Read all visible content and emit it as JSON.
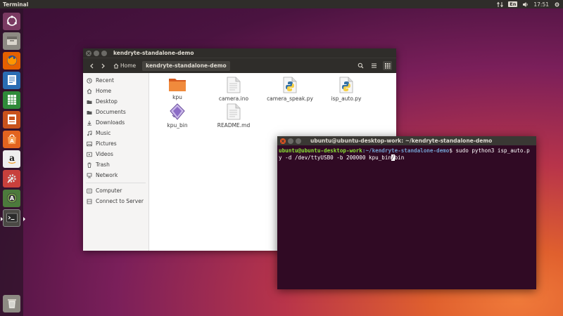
{
  "panel": {
    "app_title": "Terminal",
    "keyboard_layout": "En",
    "time": "17:51"
  },
  "launcher": {
    "items": [
      {
        "name": "Search your computer",
        "icon": "ubuntu-dash-icon"
      },
      {
        "name": "Files",
        "icon": "files-icon"
      },
      {
        "name": "Firefox Web Browser",
        "icon": "firefox-icon"
      },
      {
        "name": "LibreOffice Writer",
        "icon": "writer-icon"
      },
      {
        "name": "LibreOffice Calc",
        "icon": "calc-icon"
      },
      {
        "name": "LibreOffice Impress",
        "icon": "impress-icon"
      },
      {
        "name": "Ubuntu Software",
        "icon": "software-icon"
      },
      {
        "name": "Amazon",
        "icon": "amazon-icon"
      },
      {
        "name": "System Settings",
        "icon": "settings-icon"
      },
      {
        "name": "Software Updater",
        "icon": "updater-icon"
      },
      {
        "name": "Terminal",
        "icon": "terminal-icon"
      },
      {
        "name": "Trash",
        "icon": "trash-icon"
      }
    ]
  },
  "file_manager": {
    "title": "kendryte-standalone-demo",
    "breadcrumb": {
      "home": "Home",
      "current": "kendryte-standalone-demo"
    },
    "sidebar": {
      "places": [
        "Recent",
        "Home",
        "Desktop",
        "Documents",
        "Downloads",
        "Music",
        "Pictures",
        "Videos",
        "Trash",
        "Network"
      ],
      "devices": [
        "Computer",
        "Connect to Server"
      ]
    },
    "files": [
      {
        "name": "kpu",
        "type": "folder"
      },
      {
        "name": "camera.ino",
        "type": "text"
      },
      {
        "name": "camera_speak.py",
        "type": "python"
      },
      {
        "name": "isp_auto.py",
        "type": "python"
      },
      {
        "name": "kpu_bin",
        "type": "binary"
      },
      {
        "name": "README.md",
        "type": "text"
      }
    ]
  },
  "terminal": {
    "title": "ubuntu@ubuntu-desktop-work: ~/kendryte-standalone-demo",
    "prompt_user": "ubuntu@ubuntu-desktop-work",
    "prompt_path": ":~/kendryte-standalone-demo",
    "prompt_symbol": "$ ",
    "command_before_cursor": "sudo python3 isp_auto.py -d /dev/ttyUSB0 -b 200000 kpu_bin",
    "cursor_char": "/",
    "command_after_cursor": "bin"
  },
  "colors": {
    "accent": "#e95420",
    "terminal_bg": "#300a24",
    "prompt_user": "#8ae234",
    "prompt_path": "#729fcf"
  }
}
